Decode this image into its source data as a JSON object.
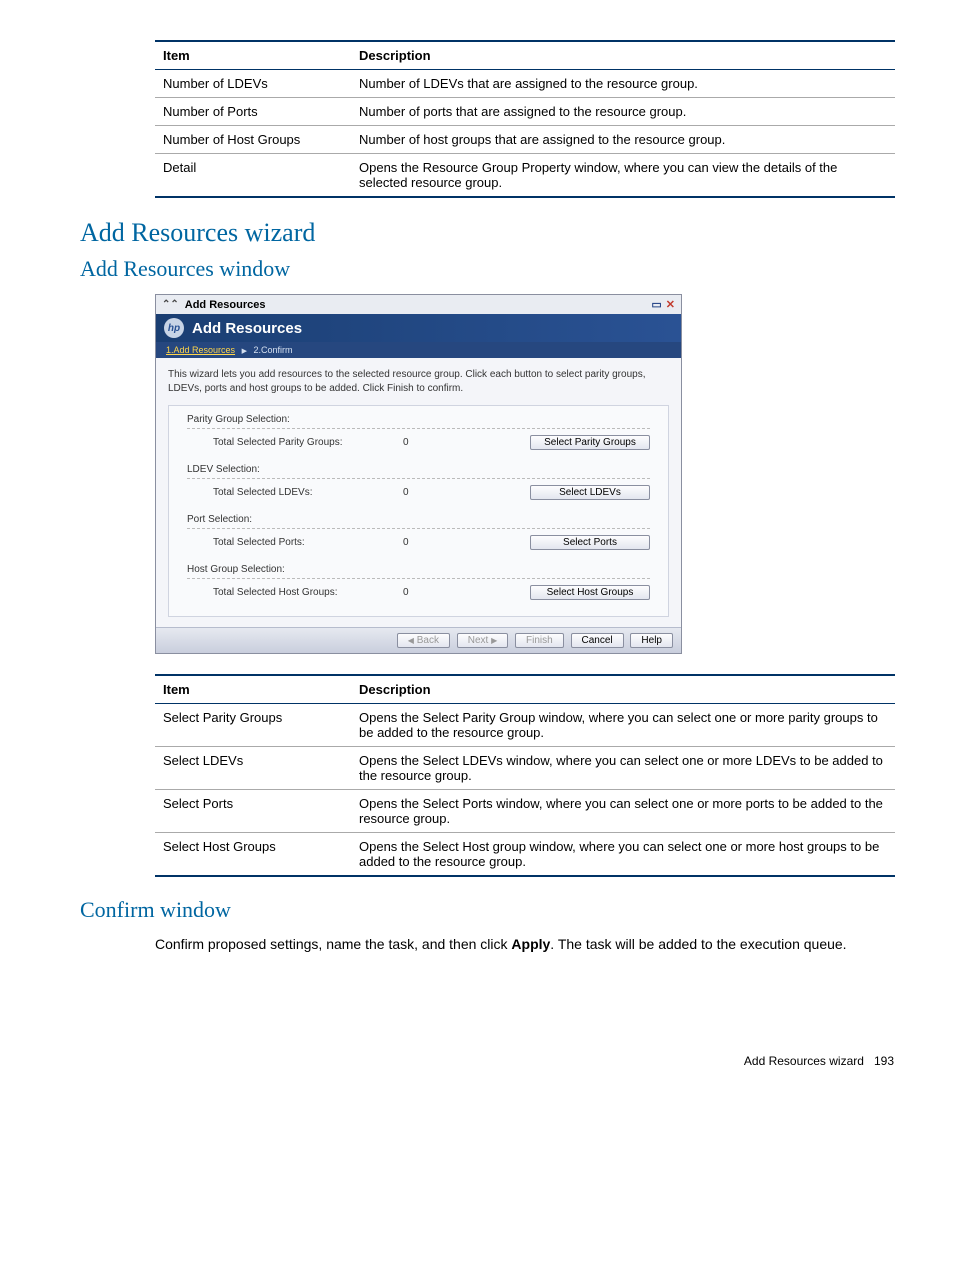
{
  "table1": {
    "headers": [
      "Item",
      "Description"
    ],
    "rows": [
      [
        "Number of LDEVs",
        "Number of LDEVs that are assigned to the resource group."
      ],
      [
        "Number of Ports",
        "Number of ports that are assigned to the resource group."
      ],
      [
        "Number of Host Groups",
        "Number of host groups that are assigned to the resource group."
      ],
      [
        "Detail",
        "Opens the Resource Group Property window, where you can view the details of the selected resource group."
      ]
    ]
  },
  "heading1": "Add Resources wizard",
  "heading2": "Add Resources window",
  "dialog": {
    "top_title": "Add Resources",
    "hp_logo_text": "hp",
    "banner_title": "Add Resources",
    "crumb_active": "1.Add Resources",
    "crumb_sep": "▶",
    "crumb_next": "2.Confirm",
    "intro": "This wizard lets you add resources to the selected resource group. Click each button to select parity groups, LDEVs, ports and host groups to be added. Click Finish to confirm.",
    "groups": [
      {
        "header": "Parity Group Selection:",
        "label": "Total Selected Parity Groups:",
        "value": "0",
        "button": "Select Parity Groups"
      },
      {
        "header": "LDEV Selection:",
        "label": "Total Selected LDEVs:",
        "value": "0",
        "button": "Select LDEVs"
      },
      {
        "header": "Port Selection:",
        "label": "Total Selected Ports:",
        "value": "0",
        "button": "Select Ports"
      },
      {
        "header": "Host Group Selection:",
        "label": "Total Selected Host Groups:",
        "value": "0",
        "button": "Select Host Groups"
      }
    ],
    "buttons": {
      "back": "Back",
      "next": "Next",
      "finish": "Finish",
      "cancel": "Cancel",
      "help": "Help"
    }
  },
  "table2": {
    "headers": [
      "Item",
      "Description"
    ],
    "rows": [
      [
        "Select Parity Groups",
        "Opens the Select Parity Group window, where you can select one or more parity groups to be added to the resource group."
      ],
      [
        "Select LDEVs",
        "Opens the Select LDEVs window, where you can select one or more LDEVs to be added to the resource group."
      ],
      [
        "Select Ports",
        "Opens the Select Ports window, where you can select one or more ports to be added to the resource group."
      ],
      [
        "Select Host Groups",
        "Opens the Select Host group window, where you can select one or more host groups to be added to the resource group."
      ]
    ]
  },
  "heading3": "Confirm window",
  "confirm_text_pre": "Confirm proposed settings, name the task, and then click ",
  "confirm_text_bold": "Apply",
  "confirm_text_post": ". The task will be added to the execution queue.",
  "footer_label": "Add Resources wizard",
  "footer_page": "193"
}
